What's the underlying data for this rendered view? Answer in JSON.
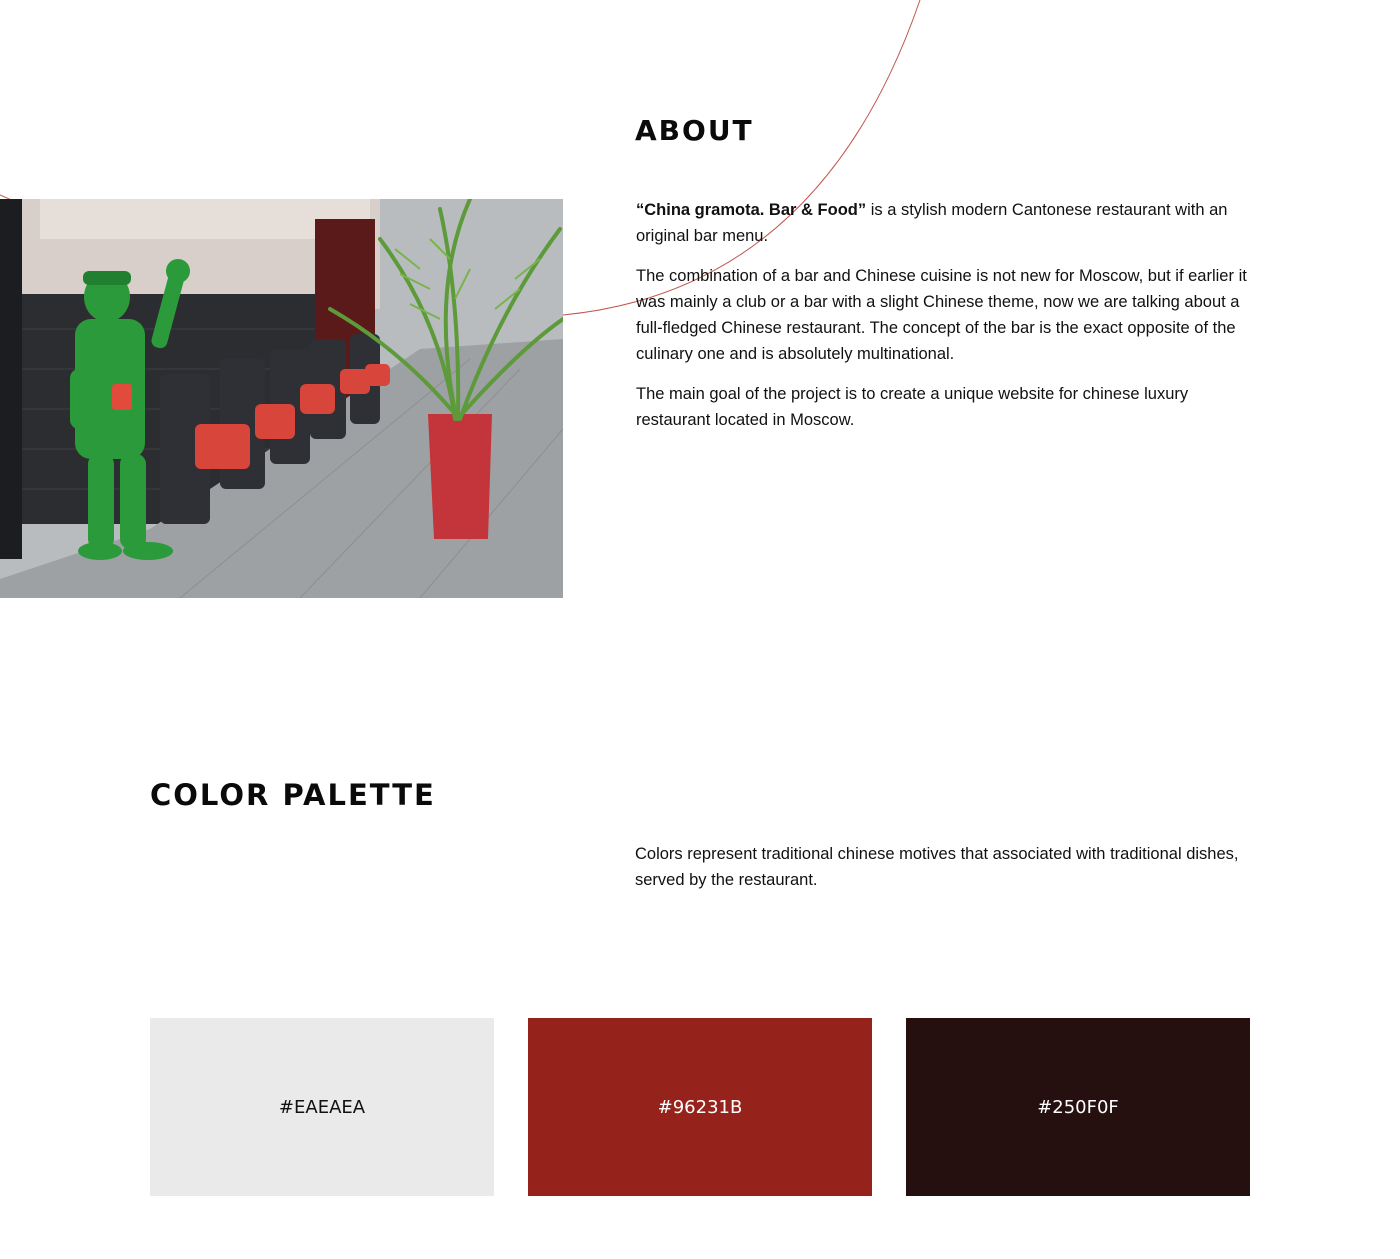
{
  "about": {
    "title": "About",
    "lead_bold": "“China gramota. Bar & Food”",
    "lead_rest": " is a stylish modern Cantonese restaurant with an original bar menu.",
    "paragraph_2": "The combination of a bar and Chinese cuisine is not new for Moscow, but if earlier it was mainly a club or a bar with a slight Chinese theme, now we are talking about a full-fledged Chinese restaurant. The concept of the bar is the exact opposite of the culinary one and is absolutely multinational.",
    "paragraph_3": "The main goal of the project is to create a unique website for chinese luxury restaurant located in Moscow."
  },
  "palette": {
    "title": "Color palette",
    "description": "Colors represent traditional chinese motives that associated with traditional dishes, served by the restaurant.",
    "swatches": [
      {
        "label": "#EAEAEA",
        "color": "#eaeaea",
        "text_color": "#111111"
      },
      {
        "label": "#96231B",
        "color": "#96231b",
        "text_color": "#ffffff"
      },
      {
        "label": "#250F0F",
        "color": "#250f0f",
        "text_color": "#ffffff"
      }
    ]
  },
  "colors": {
    "accent_line": "#c0574f"
  }
}
